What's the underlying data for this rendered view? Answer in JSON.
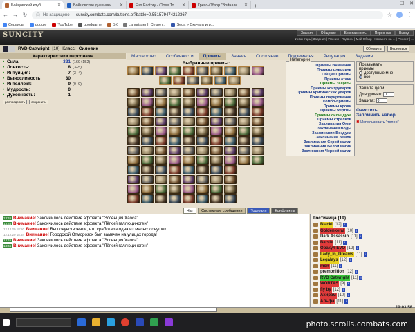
{
  "browser": {
    "tabs": [
      {
        "label": "Бойцовский клуб",
        "color": "#b06030",
        "active": true
      },
      {
        "label": "Бойцовские дневники - RVD C...",
        "color": "#2060c0",
        "active": false
      },
      {
        "label": "Fun Factory - Close To You (Clo...",
        "color": "#cc0000",
        "active": false
      },
      {
        "label": "Грехо-Обзор \"Война миров Z\"",
        "color": "#cc0000",
        "active": false
      }
    ],
    "security_label": "Не защищено",
    "url": "suncity.combats.com/buttons.pl?battle=0.551579474212367",
    "bookmarks": [
      {
        "label": "Сервисы",
        "color": "#4285f4"
      },
      {
        "label": "google",
        "color": "#4285f4"
      },
      {
        "label": "YouTube",
        "color": "#cc0000"
      },
      {
        "label": "goodgame",
        "color": "#555555"
      },
      {
        "label": "БК",
        "color": "#b06030"
      },
      {
        "label": "Langrisser II Секрет...",
        "color": "#777777"
      },
      {
        "label": "Sega » Скачать игр...",
        "color": "#3355aa"
      }
    ]
  },
  "game": {
    "logo": "SUNCITY",
    "top_nav": [
      "Знания",
      "Общение",
      "Безопасность",
      "Персонаж",
      "Выход"
    ],
    "sub_nav": "Инвентарь | Задания | Умения | Подвиги | Мой Обзор | Нажмите на ... | Ремонт | ...",
    "character": {
      "name": "RVD Catwright",
      "level": "[10]",
      "class_label": "Класс:",
      "class": "Силовик"
    },
    "buttons": {
      "refresh": "Обновить",
      "back": "Вернуться"
    }
  },
  "tabs": {
    "items": [
      "Мастерство",
      "Особенности",
      "Приемы",
      "Знания",
      "Состояние",
      "Подземелья",
      "Репутация",
      "Задания"
    ],
    "selected": "Приемы"
  },
  "stats": {
    "header": "Характеристики персонажа",
    "rows": [
      {
        "name": "Сила:",
        "value": "321",
        "extra": "(169+152)",
        "blue": true
      },
      {
        "name": "Ловкость:",
        "value": "8",
        "extra": "(3+5)",
        "blue": false
      },
      {
        "name": "Интуиция:",
        "value": "7",
        "extra": "(3+4)",
        "blue": false
      },
      {
        "name": "Выносливость:",
        "value": "30",
        "extra": "",
        "blue": false
      },
      {
        "name": "Интеллект:",
        "value": "9",
        "extra": "(0+9)",
        "blue": false
      },
      {
        "name": "Мудрость:",
        "value": "0",
        "extra": "",
        "blue": false
      },
      {
        "name": "Духовность:",
        "value": "1",
        "extra": "",
        "blue": false
      }
    ],
    "btn_distribute": "распределить",
    "btn_save": "сохранить"
  },
  "skills": {
    "selected_title": "Выбранные приемы:"
  },
  "categories": {
    "legend": "Категории",
    "items": [
      {
        "label": "Приемы Внимания",
        "green": false
      },
      {
        "label": "Приемы новичков",
        "green": false
      },
      {
        "label": "Общие Приемы",
        "green": false
      },
      {
        "label": "Приемы атаки",
        "green": false
      },
      {
        "label": "Приемы защиты",
        "green": true
      },
      {
        "label": "Приемы контрударов",
        "green": false
      },
      {
        "label": "Приемы критических ударов",
        "green": false
      },
      {
        "label": "Приемы парирования",
        "green": false
      },
      {
        "label": "Комбо-приемы",
        "green": false
      },
      {
        "label": "Приемы крови",
        "green": false
      },
      {
        "label": "Приемы жертвы",
        "green": false
      },
      {
        "label": "Приемы силы духа",
        "green": true
      },
      {
        "label": "Приемы стрелков",
        "green": false
      },
      {
        "label": "Заклинания Огня",
        "green": false
      },
      {
        "label": "Заклинания Воды",
        "green": false
      },
      {
        "label": "Заклинания Воздуха",
        "green": false
      },
      {
        "label": "Заклинания Земли",
        "green": false
      },
      {
        "label": "Заклинания Серой магии",
        "green": false
      },
      {
        "label": "Заклинания Белой магии",
        "green": false
      },
      {
        "label": "Заклинания Черной магии",
        "green": false
      }
    ]
  },
  "options": {
    "show_legend": "Показывать",
    "show_sub": "приемы",
    "radio_available": "доступные мне",
    "radio_all": "все",
    "protect_legend": "Защита цели",
    "for_levels": "Для уровня:",
    "level_value": "0",
    "protection": "Защита:",
    "protection_value": "0",
    "clear": "Очистить",
    "remember": "Запомнить набор",
    "use_top": "Использовать \"топор\""
  },
  "chat": {
    "tabs": [
      "Чат",
      "Системные сообщения",
      "Торговля",
      "Конфликты"
    ],
    "messages": [
      {
        "time": "13:45",
        "warn": "Внимание!",
        "text": "Закончилось действие эффекта \"Эссенция Хаоса\""
      },
      {
        "time": "13:45",
        "warn": "Внимание!",
        "text": "Закончилось действие эффекта \"Лёгкий галлюциноген\""
      },
      {
        "time": "12.12.20 18:50",
        "warn": "Внимание!",
        "text": "Вы почувствовали, что сработала одна из малых ловушек."
      },
      {
        "time": "12.12.20 18:54",
        "warn": "Внимание!",
        "text": "Городской Отморозок был замечен на улицах города!"
      },
      {
        "time": "13:45",
        "warn": "Внимание!",
        "text": "Закончилось действие эффекта \"Эссенция Хаоса\""
      },
      {
        "time": "13:45",
        "warn": "Внимание!",
        "text": "Закончилось действие эффекта \"Лёгкий галлюциноген\""
      }
    ]
  },
  "online": {
    "title": "Гостиница (19)",
    "users": [
      {
        "name": "Blacki",
        "level": "[12]",
        "hl": "yellow"
      },
      {
        "name": "Goldenkeral",
        "level": "[10]",
        "hl": "red"
      },
      {
        "name": "Dark Assassin",
        "level": "[11]",
        "hl": ""
      },
      {
        "name": "Barsik",
        "level": "[11]",
        "hl": "red"
      },
      {
        "name": "Оракул EVO",
        "level": "[12]",
        "hl": "red"
      },
      {
        "name": "Lady_In_Dreams",
        "level": "[11]",
        "hl": "yellow"
      },
      {
        "name": "Legalays",
        "level": "[12]",
        "hl": "yellow"
      },
      {
        "name": "mon",
        "level": "[11]",
        "hl": "red"
      },
      {
        "name": "premonition",
        "level": "[12]",
        "hl": ""
      },
      {
        "name": "RVD Catwright",
        "level": "[11]",
        "hl": "green"
      },
      {
        "name": "WORTAS",
        "level": "[9]",
        "hl": "red"
      },
      {
        "name": "fly by",
        "level": "[12]",
        "hl": "red"
      },
      {
        "name": "Ахирам",
        "level": "[10]",
        "hl": "red"
      },
      {
        "name": "Альфа",
        "level": "[11]",
        "hl": "red"
      }
    ]
  },
  "footer": {
    "time": "19:03:58",
    "watermark": "photo.scrolls.combats.com"
  }
}
